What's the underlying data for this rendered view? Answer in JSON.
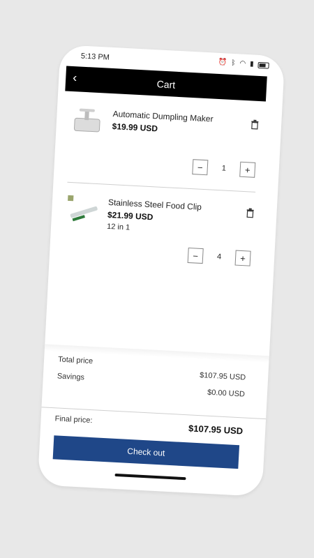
{
  "status_bar": {
    "time": "5:13 PM",
    "icons": [
      "alarm-icon",
      "bluetooth-icon",
      "wifi-icon",
      "signal-icon",
      "battery-icon"
    ]
  },
  "header": {
    "title": "Cart",
    "back_icon": "chevron-left-icon"
  },
  "cart": {
    "items": [
      {
        "name": "Automatic Dumpling Maker",
        "price": "$19.99 USD",
        "variant": "",
        "quantity": "1"
      },
      {
        "name": "Stainless Steel Food Clip",
        "price": "$21.99 USD",
        "variant": "12 in 1",
        "quantity": "4"
      }
    ]
  },
  "summary": {
    "total_label": "Total price",
    "total_value": "$107.95 USD",
    "savings_label": "Savings",
    "savings_value": "$0.00 USD",
    "final_label": "Final price:",
    "final_value": "$107.95 USD"
  },
  "actions": {
    "checkout_label": "Check out"
  },
  "colors": {
    "accent": "#1f4788",
    "header_bg": "#000000"
  }
}
